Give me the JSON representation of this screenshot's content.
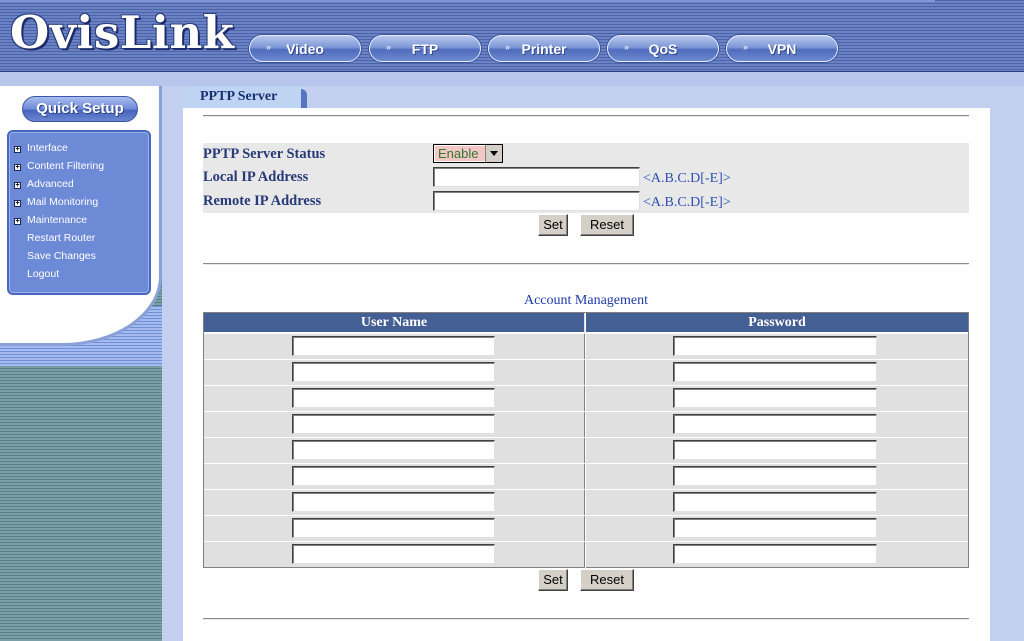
{
  "header": {
    "logo": "OvisLink",
    "nav": [
      {
        "label": "Video",
        "icon": "double-arrow-icon"
      },
      {
        "label": "FTP",
        "icon": "double-arrow-icon"
      },
      {
        "label": "Printer",
        "icon": "double-arrow-icon"
      },
      {
        "label": "QoS",
        "icon": "double-arrow-icon"
      },
      {
        "label": "VPN",
        "icon": "double-arrow-icon"
      }
    ]
  },
  "sidebar": {
    "quick_setup": "Quick Setup",
    "items": [
      {
        "label": "Interface",
        "expandable": true
      },
      {
        "label": "Content Filtering",
        "expandable": true
      },
      {
        "label": "Advanced",
        "expandable": true
      },
      {
        "label": "Mail Monitoring",
        "expandable": true
      },
      {
        "label": "Maintenance",
        "expandable": true
      },
      {
        "label": "Restart Router",
        "expandable": false
      },
      {
        "label": "Save Changes",
        "expandable": false
      },
      {
        "label": "Logout",
        "expandable": false
      }
    ]
  },
  "main": {
    "tab": "PPTP Server",
    "form": {
      "status_label": "PPTP Server Status",
      "status_value": "Enable",
      "local_ip_label": "Local IP Address",
      "local_ip_value": "",
      "local_ip_hint": "<A.B.C.D[-E]>",
      "remote_ip_label": "Remote IP Address",
      "remote_ip_value": "",
      "remote_ip_hint": "<A.B.C.D[-E]>",
      "set_label": "Set",
      "reset_label": "Reset"
    },
    "accounts": {
      "title": "Account Management",
      "columns": [
        "User Name",
        "Password"
      ],
      "rows": [
        {
          "user": "",
          "password": ""
        },
        {
          "user": "",
          "password": ""
        },
        {
          "user": "",
          "password": ""
        },
        {
          "user": "",
          "password": ""
        },
        {
          "user": "",
          "password": ""
        },
        {
          "user": "",
          "password": ""
        },
        {
          "user": "",
          "password": ""
        },
        {
          "user": "",
          "password": ""
        },
        {
          "user": "",
          "password": ""
        }
      ],
      "set_label": "Set",
      "reset_label": "Reset"
    }
  },
  "colors": {
    "header_blue": "#6a82c4",
    "sidebar_menu": "#6d8ad6",
    "table_header": "#445f93",
    "label_text": "#283a78",
    "hint_text": "#2f4fb0"
  }
}
